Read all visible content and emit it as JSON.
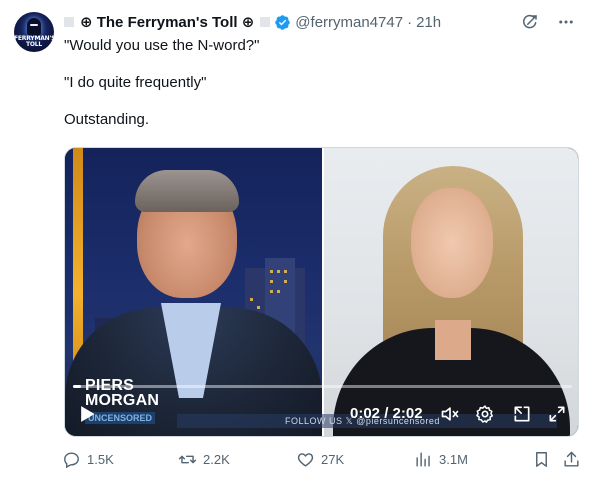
{
  "tweet": {
    "display_name": "⊕ The Ferryman's Toll ⊕",
    "handle": "@ferryman4747",
    "separator": "·",
    "time": "21h",
    "avatar_text": "FERRYMAN'S TOLL",
    "lines": [
      "\"Would you use the N-word?\"",
      "\"I do quite frequently\"",
      "Outstanding."
    ]
  },
  "media": {
    "logo_line1": "PIERS",
    "logo_line2": "MORGAN",
    "logo_sub": "UNCENSORED",
    "chyron": "FOLLOW US  𝕏  @piersuncensored",
    "time_display": "0:02 / 2:02",
    "progress": 0.017
  },
  "actions": {
    "replies": "1.5K",
    "reposts": "2.2K",
    "likes": "27K",
    "views": "3.1M"
  },
  "colors": {
    "text": "#0f1419",
    "muted": "#536471",
    "verified": "#1d9bf0"
  }
}
